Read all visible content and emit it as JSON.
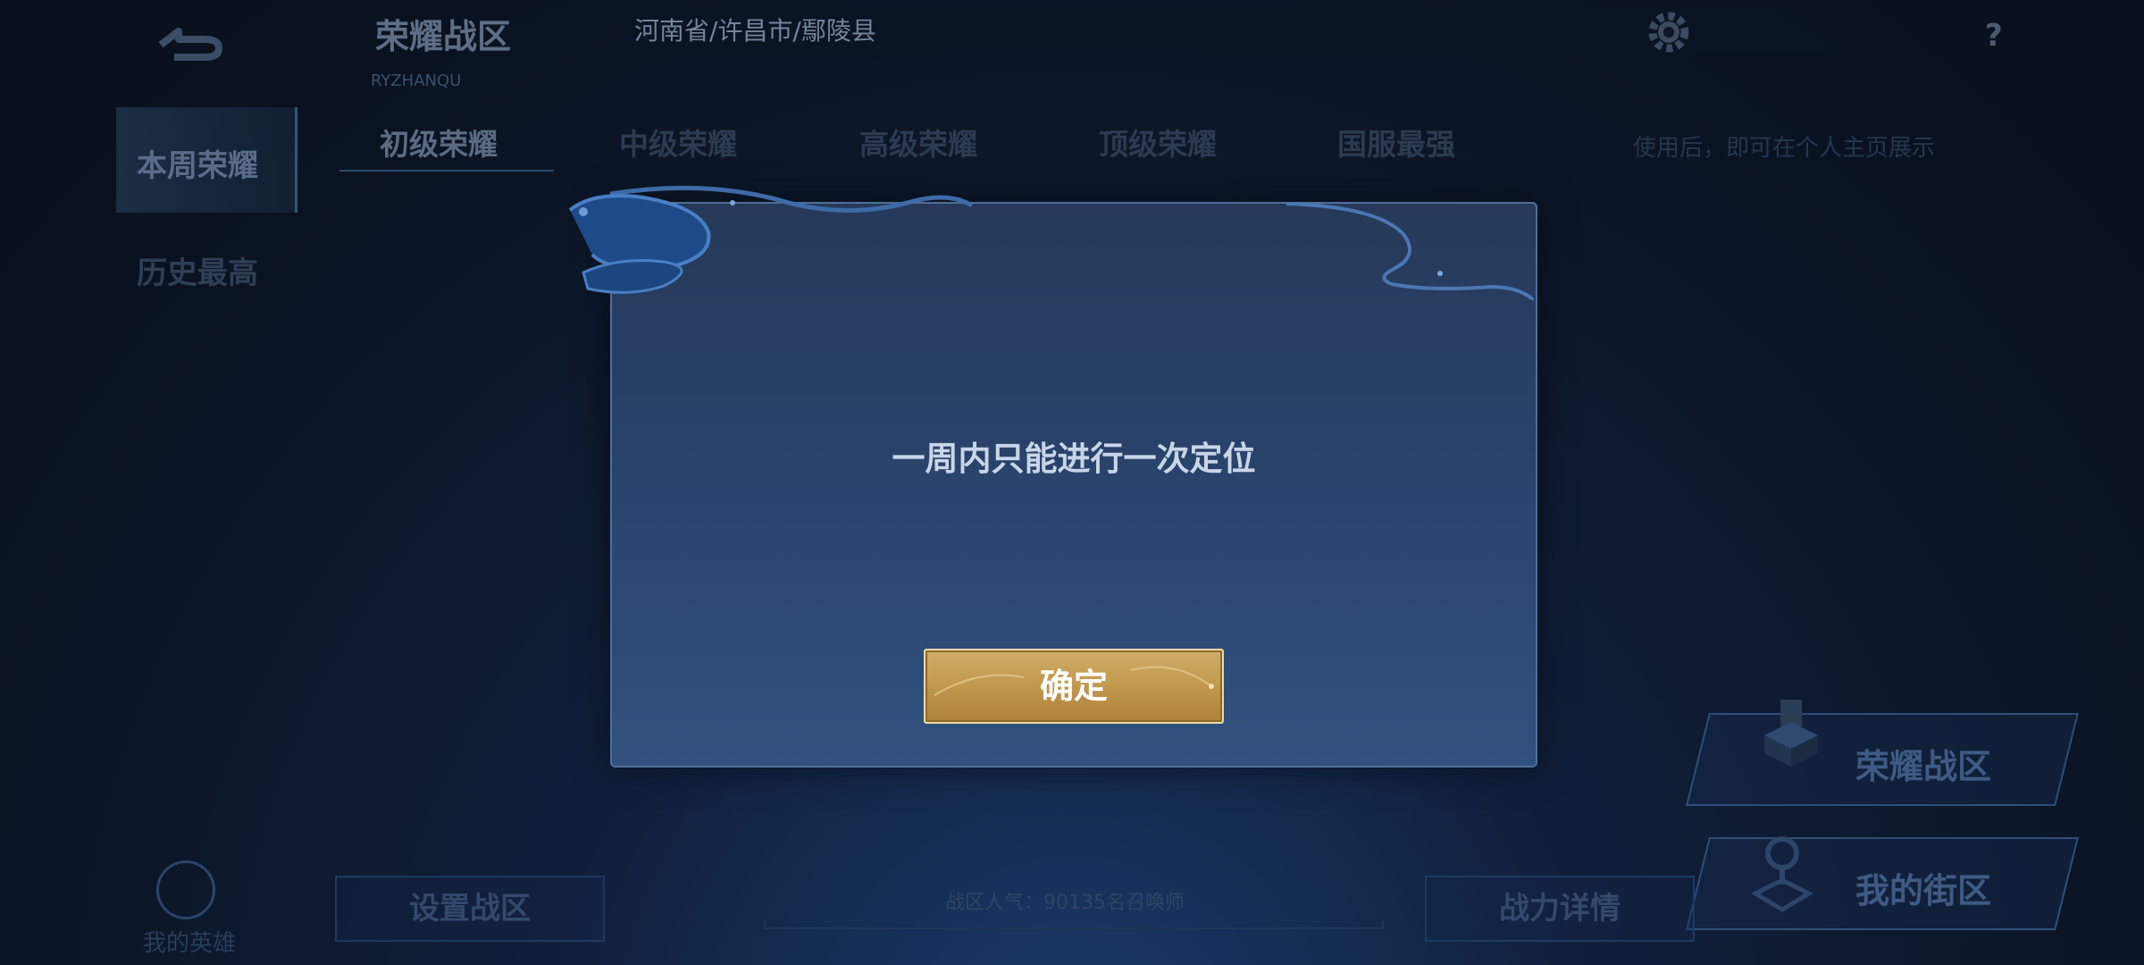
{
  "topbar": {
    "title": "荣耀战区",
    "subtitle": "RYZHANQU",
    "location": "河南省/许昌市/鄢陵县",
    "help": "?"
  },
  "leftnav": {
    "items": [
      {
        "label": "本周荣耀",
        "active": true
      },
      {
        "label": "历史最高",
        "active": false
      }
    ]
  },
  "tabs": [
    {
      "label": "初级荣耀",
      "active": true
    },
    {
      "label": "中级荣耀",
      "active": false
    },
    {
      "label": "高级荣耀",
      "active": false
    },
    {
      "label": "顶级荣耀",
      "active": false
    },
    {
      "label": "国服最强",
      "active": false
    }
  ],
  "tab_hint": "使用后，即可在个人主页展示",
  "side_buttons": {
    "zone": "荣耀战区",
    "street": "我的街区"
  },
  "bottom": {
    "set_zone": "设置战区",
    "popularity": "战区人气：90135名召唤师",
    "power_details": "战力详情",
    "my_hero": "我的英雄"
  },
  "modal": {
    "message": "一周内只能进行一次定位",
    "confirm": "确定"
  },
  "colors": {
    "modal_bg": "#2b4670",
    "button_gold": "#c39a50",
    "text_light": "#c8d6ea"
  }
}
